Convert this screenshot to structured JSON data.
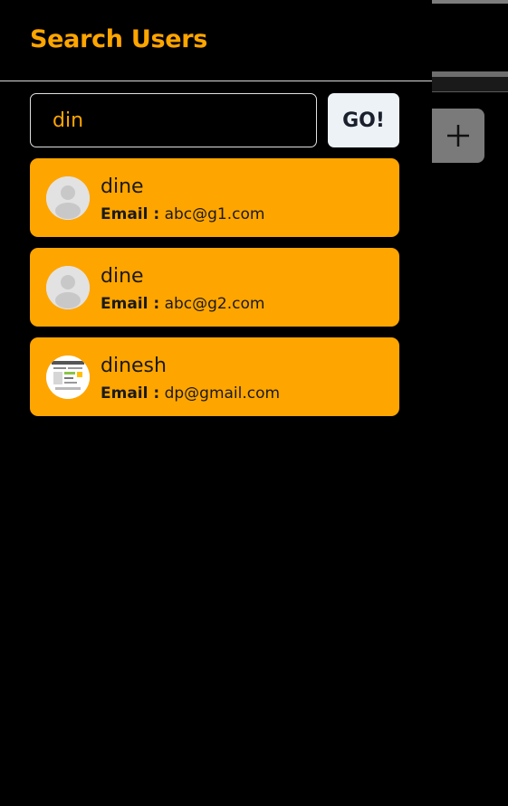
{
  "drawer": {
    "title": "Search Users"
  },
  "search": {
    "value": "din",
    "go_label": "GO!"
  },
  "results": [
    {
      "name": "dine",
      "email_label": "Email :",
      "email": "abc@g1.com",
      "avatar": "default-avatar"
    },
    {
      "name": "dine",
      "email_label": "Email :",
      "email": "abc@g2.com",
      "avatar": "default-avatar"
    },
    {
      "name": "dinesh",
      "email_label": "Email :",
      "email": "dp@gmail.com",
      "avatar": "photo-avatar"
    }
  ],
  "colors": {
    "accent": "#ffa500",
    "background": "#000000",
    "card": "#ffa500",
    "button": "#edf2f7"
  },
  "background_app": {
    "add_icon": "plus-icon"
  }
}
